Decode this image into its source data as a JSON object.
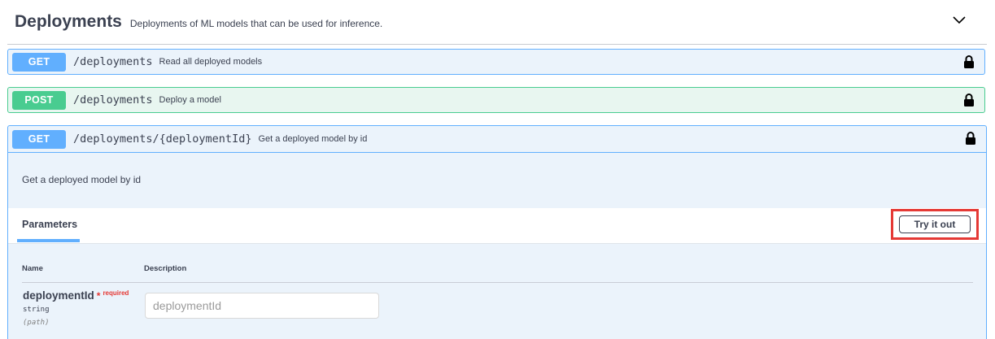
{
  "tag": {
    "title": "Deployments",
    "description": "Deployments of ML models that can be used for inference."
  },
  "operations": [
    {
      "method": "GET",
      "path": "/deployments",
      "summary": "Read all deployed models"
    },
    {
      "method": "POST",
      "path": "/deployments",
      "summary": "Deploy a model"
    },
    {
      "method": "GET",
      "path": "/deployments/{deploymentId}",
      "summary": "Get a deployed model by id"
    }
  ],
  "expanded": {
    "description": "Get a deployed model by id",
    "parameters_tab": "Parameters",
    "try_it_out": "Try it out",
    "columns": {
      "name": "Name",
      "description": "Description"
    },
    "param": {
      "name": "deploymentId",
      "required_star": "*",
      "required_label": "required",
      "type": "string",
      "in": "(path)",
      "placeholder": "deploymentId"
    }
  },
  "colors": {
    "get": "#61affe",
    "post": "#49cc90",
    "highlight": "#e53935"
  },
  "icons": {
    "collapse": "chevron-down-icon",
    "lock": "lock-icon"
  }
}
